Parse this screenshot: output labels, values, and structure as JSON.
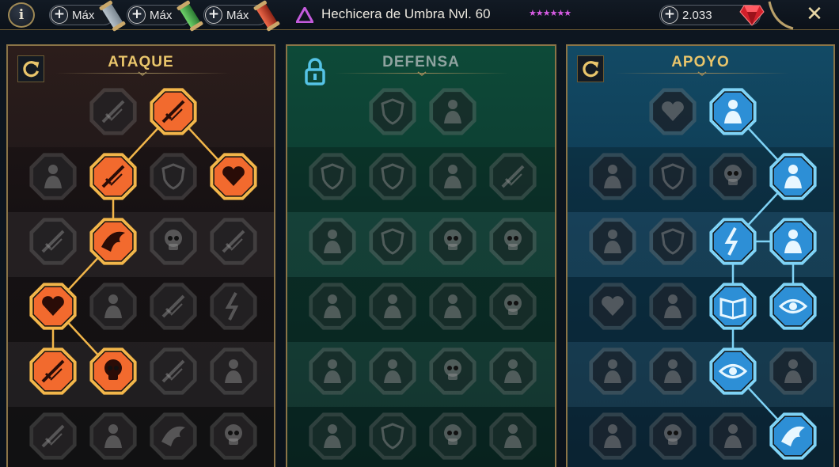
{
  "topbar": {
    "info_label": "i",
    "resources": [
      {
        "plus": "+",
        "label": "Máx",
        "scroll_color": "silver"
      },
      {
        "plus": "+",
        "label": "Máx",
        "scroll_color": "green"
      },
      {
        "plus": "+",
        "label": "Máx",
        "scroll_color": "red"
      }
    ],
    "champion_name": "Hechicera de Umbra Nvl. 60",
    "stars": "★★★★★★",
    "affinity_color": "#c45bdc",
    "gems": {
      "plus": "+",
      "value": "2.033"
    },
    "close_label": "✕"
  },
  "trees": [
    {
      "key": "ataque",
      "title": "ATAQUE",
      "title_color": "#e9c56b",
      "corner": "refresh-icon",
      "active_color": "#f26a2e",
      "active_border": "#f2b64a",
      "nodes": [
        {
          "icon": "crossed-swords-icon",
          "active": false
        },
        {
          "icon": "dagger-strike-icon",
          "active": true
        },
        {
          "icon": "demon-figure-icon",
          "active": false
        },
        {
          "icon": "triple-slash-icon",
          "active": true
        },
        {
          "icon": "shield-break-icon",
          "active": false
        },
        {
          "icon": "bleeding-heart-icon",
          "active": true
        },
        {
          "icon": "fist-strike-icon",
          "active": false
        },
        {
          "icon": "fanged-mouth-icon",
          "active": true
        },
        {
          "icon": "skull-slash-icon",
          "active": false
        },
        {
          "icon": "axe-hand-icon",
          "active": false
        },
        {
          "icon": "flaming-heart-icon",
          "active": true
        },
        {
          "icon": "gauntlet-icon",
          "active": false
        },
        {
          "icon": "axe-icon",
          "active": false
        },
        {
          "icon": "chain-lightning-icon",
          "active": false
        },
        {
          "icon": "claw-strike-icon",
          "active": true
        },
        {
          "icon": "twin-skulls-icon",
          "active": true
        },
        {
          "icon": "broken-sword-icon",
          "active": false
        },
        {
          "icon": "warrior-icon",
          "active": false
        },
        {
          "icon": "crossed-swords-sparks-icon",
          "active": false
        },
        {
          "icon": "knight-helm-icon",
          "active": false
        },
        {
          "icon": "beast-icon",
          "active": false
        },
        {
          "icon": "skull-crest-icon",
          "active": false
        }
      ]
    },
    {
      "key": "defensa",
      "title": "DEFENSA",
      "title_color": "#8fa3a0",
      "corner": "lock-icon",
      "active_color": "#2fc7a0",
      "active_border": "#6fe4c2",
      "nodes": [
        {
          "icon": "cracked-shield-icon",
          "active": false
        },
        {
          "icon": "raised-fist-icon",
          "active": false
        },
        {
          "icon": "chevron-shield-icon",
          "active": false
        },
        {
          "icon": "flame-shield-icon",
          "active": false
        },
        {
          "icon": "rider-icon",
          "active": false
        },
        {
          "icon": "blade-block-icon",
          "active": false
        },
        {
          "icon": "spike-guard-icon",
          "active": false
        },
        {
          "icon": "split-shield-icon",
          "active": false
        },
        {
          "icon": "hooded-skull-icon",
          "active": false
        },
        {
          "icon": "halo-skull-icon",
          "active": false
        },
        {
          "icon": "tall-figure-icon",
          "active": false
        },
        {
          "icon": "hourglass-spider-icon",
          "active": false
        },
        {
          "icon": "open-hand-icon",
          "active": false
        },
        {
          "icon": "bull-skull-icon",
          "active": false
        },
        {
          "icon": "speed-runner-icon",
          "active": false
        },
        {
          "icon": "drip-icon",
          "active": false
        },
        {
          "icon": "skull-burst-icon",
          "active": false
        },
        {
          "icon": "deflect-icon",
          "active": false
        },
        {
          "icon": "armored-warrior-icon",
          "active": false
        },
        {
          "icon": "round-shield-icon",
          "active": false
        },
        {
          "icon": "bald-skull-icon",
          "active": false
        },
        {
          "icon": "flexing-figure-icon",
          "active": false
        }
      ]
    },
    {
      "key": "apoyo",
      "title": "APOYO",
      "title_color": "#e9c56b",
      "corner": "refresh-icon",
      "active_color": "#2d8fd6",
      "active_border": "#7fd3f6",
      "nodes": [
        {
          "icon": "heart-sparkle-icon",
          "active": false
        },
        {
          "icon": "swirl-fist-icon",
          "active": true
        },
        {
          "icon": "praying-hands-icon",
          "active": false
        },
        {
          "icon": "arc-shield-icon",
          "active": false
        },
        {
          "icon": "smoke-skull-icon",
          "active": false
        },
        {
          "icon": "speed-boot-icon",
          "active": true
        },
        {
          "icon": "sparkle-figure-icon",
          "active": false
        },
        {
          "icon": "lightning-shield-icon",
          "active": false
        },
        {
          "icon": "shatter-icon",
          "active": true
        },
        {
          "icon": "twin-figures-icon",
          "active": true
        },
        {
          "icon": "chained-heart-icon",
          "active": false
        },
        {
          "icon": "comet-icon",
          "active": false
        },
        {
          "icon": "open-book-icon",
          "active": true
        },
        {
          "icon": "glaring-eyes-icon",
          "active": true
        },
        {
          "icon": "compass-star-icon",
          "active": false
        },
        {
          "icon": "boot-icon",
          "active": false
        },
        {
          "icon": "all-seeing-eye-icon",
          "active": true
        },
        {
          "icon": "leaping-figure-icon",
          "active": false
        },
        {
          "icon": "potion-icon",
          "active": false
        },
        {
          "icon": "skull-icon",
          "active": false
        },
        {
          "icon": "grasping-hand-icon",
          "active": false
        },
        {
          "icon": "eagle-icon",
          "active": true
        }
      ]
    }
  ]
}
